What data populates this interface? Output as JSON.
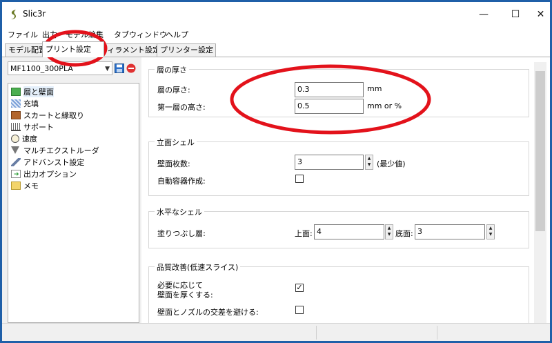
{
  "window": {
    "title": "Slic3r",
    "controls": {
      "minimize": "—",
      "maximize": "☐",
      "close": "✕"
    }
  },
  "menu": [
    "ファイル",
    "出力",
    "モデル編集",
    "タブウィンドウ",
    "ヘルプ"
  ],
  "tabs": [
    "モデル配置",
    "プリント設定",
    "フィラメント設定",
    "プリンター設定"
  ],
  "active_tab": "プリント設定",
  "preset": {
    "value": "MF1100_300PLA"
  },
  "sidebar": {
    "items": [
      {
        "label": "層と壁面",
        "icon": "layers-icon",
        "selected": true
      },
      {
        "label": "充填",
        "icon": "infill-icon"
      },
      {
        "label": "スカートと縁取り",
        "icon": "skirt-icon"
      },
      {
        "label": "サポート",
        "icon": "support-icon"
      },
      {
        "label": "速度",
        "icon": "clock-icon"
      },
      {
        "label": "マルチエクストルーダ",
        "icon": "funnel-icon"
      },
      {
        "label": "アドバンスト設定",
        "icon": "wrench-icon"
      },
      {
        "label": "出力オプション",
        "icon": "output-icon"
      },
      {
        "label": "メモ",
        "icon": "note-icon"
      }
    ]
  },
  "groups": {
    "layer_height": {
      "title": "層の厚さ",
      "layer_height_label": "層の厚さ:",
      "layer_height_value": "0.3",
      "layer_height_unit": "mm",
      "first_layer_label": "第一層の高さ:",
      "first_layer_value": "0.5",
      "first_layer_unit": "mm or %"
    },
    "vertical_shells": {
      "title": "立面シェル",
      "perimeters_label": "壁面枚数:",
      "perimeters_value": "3",
      "perimeters_note": "(最少値)",
      "spiral_vase_label": "自動容器作成:",
      "spiral_vase_checked": false
    },
    "horizontal_shells": {
      "title": "水平なシェル",
      "solid_layers_label": "塗りつぶし層:",
      "top_label": "上面:",
      "top_value": "4",
      "bottom_label": "底面:",
      "bottom_value": "3"
    },
    "quality": {
      "title": "品質改善(低速スライス)",
      "extra_perimeters_label_line1": "必要に応じて",
      "extra_perimeters_label_line2": "壁面を厚くする:",
      "extra_perimeters_checked": true,
      "avoid_crossing_label": "壁面とノズルの交差を避ける:",
      "avoid_crossing_checked": false
    }
  },
  "annotation_color": "#e3121b"
}
